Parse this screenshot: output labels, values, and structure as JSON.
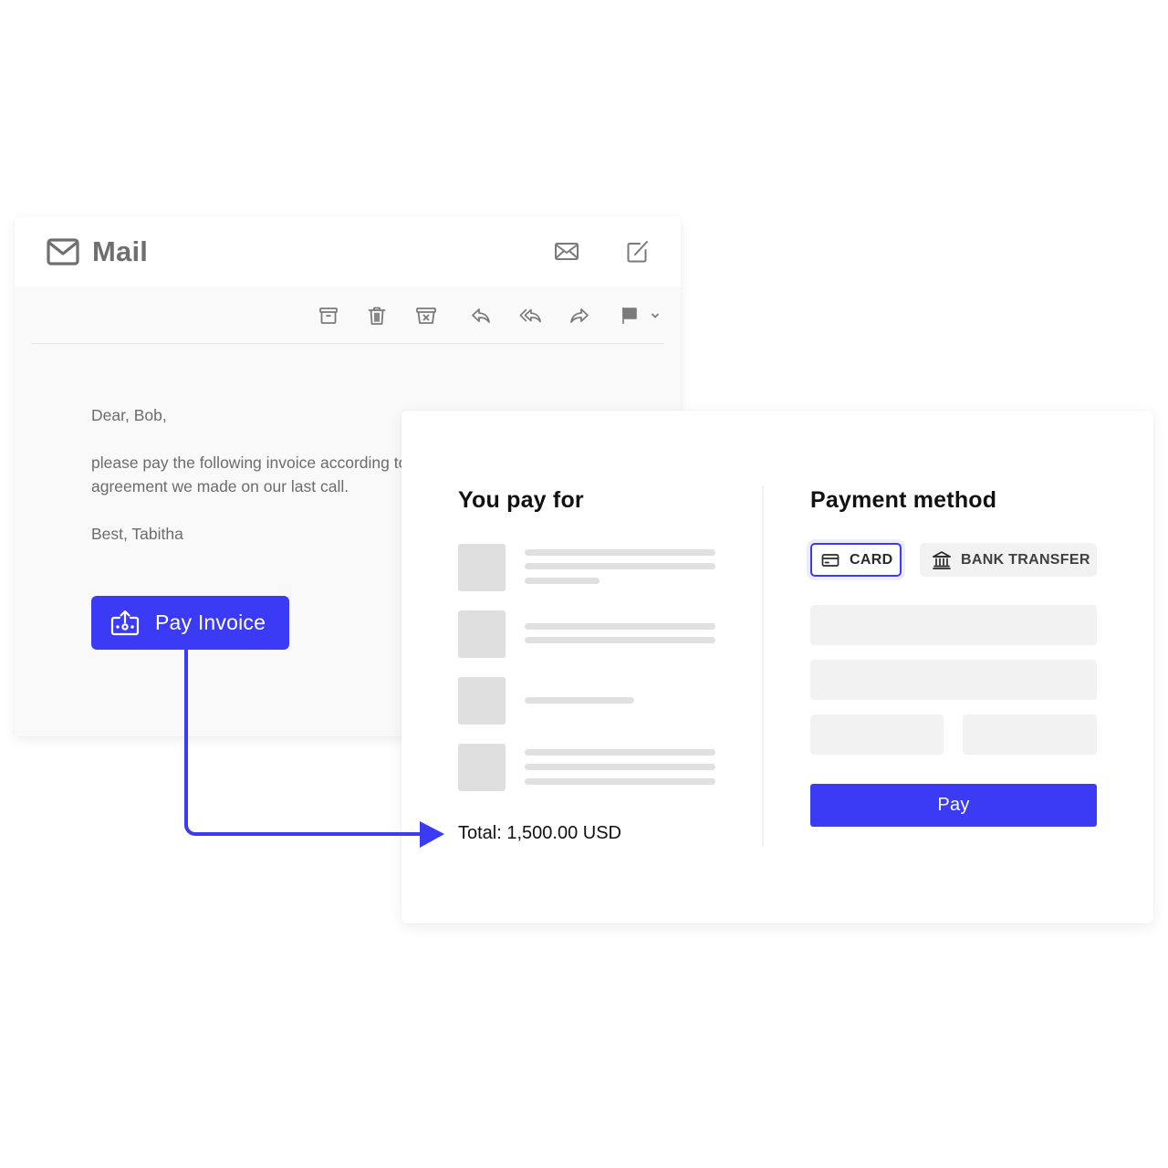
{
  "colors": {
    "accent": "#3b3bf5",
    "icon_gray": "#707070",
    "placeholder_gray": "#e0e0e0",
    "field_bg": "#f2f2f2"
  },
  "mail": {
    "title": "Mail",
    "header_actions": [
      {
        "name": "inbox",
        "icon": "envelope-icon"
      },
      {
        "name": "compose",
        "icon": "compose-icon"
      }
    ],
    "toolbar": [
      {
        "name": "archive",
        "icon": "archive-icon"
      },
      {
        "name": "delete",
        "icon": "trash-icon"
      },
      {
        "name": "junk",
        "icon": "junk-icon"
      },
      {
        "name": "reply",
        "icon": "reply-icon"
      },
      {
        "name": "reply-all",
        "icon": "reply-all-icon"
      },
      {
        "name": "forward",
        "icon": "forward-icon"
      },
      {
        "name": "flag",
        "icon": "flag-icon"
      },
      {
        "name": "more",
        "icon": "chevron-down-icon"
      }
    ],
    "body": {
      "greeting": "Dear, Bob,",
      "line1": "please pay the following invoice according to the",
      "line2": "agreement we made on our last call.",
      "signoff": "Best, Tabitha"
    },
    "pay_invoice_label": "Pay Invoice"
  },
  "payment": {
    "you_pay_for_title": "You pay for",
    "items": [
      {
        "lines": 3
      },
      {
        "lines": 2
      },
      {
        "lines": 1
      },
      {
        "lines": 3
      }
    ],
    "total": "Total: 1,500.00 USD",
    "method_title": "Payment method",
    "methods": [
      {
        "label": "CARD",
        "icon": "credit-card-icon",
        "selected": true
      },
      {
        "label": "BANK TRANSFER",
        "icon": "bank-icon",
        "selected": false
      }
    ],
    "fields": [
      {
        "name": "card-number",
        "value": ""
      },
      {
        "name": "cardholder-name",
        "value": ""
      },
      {
        "name": "expiry",
        "value": ""
      },
      {
        "name": "cvc",
        "value": ""
      }
    ],
    "pay_label": "Pay"
  }
}
